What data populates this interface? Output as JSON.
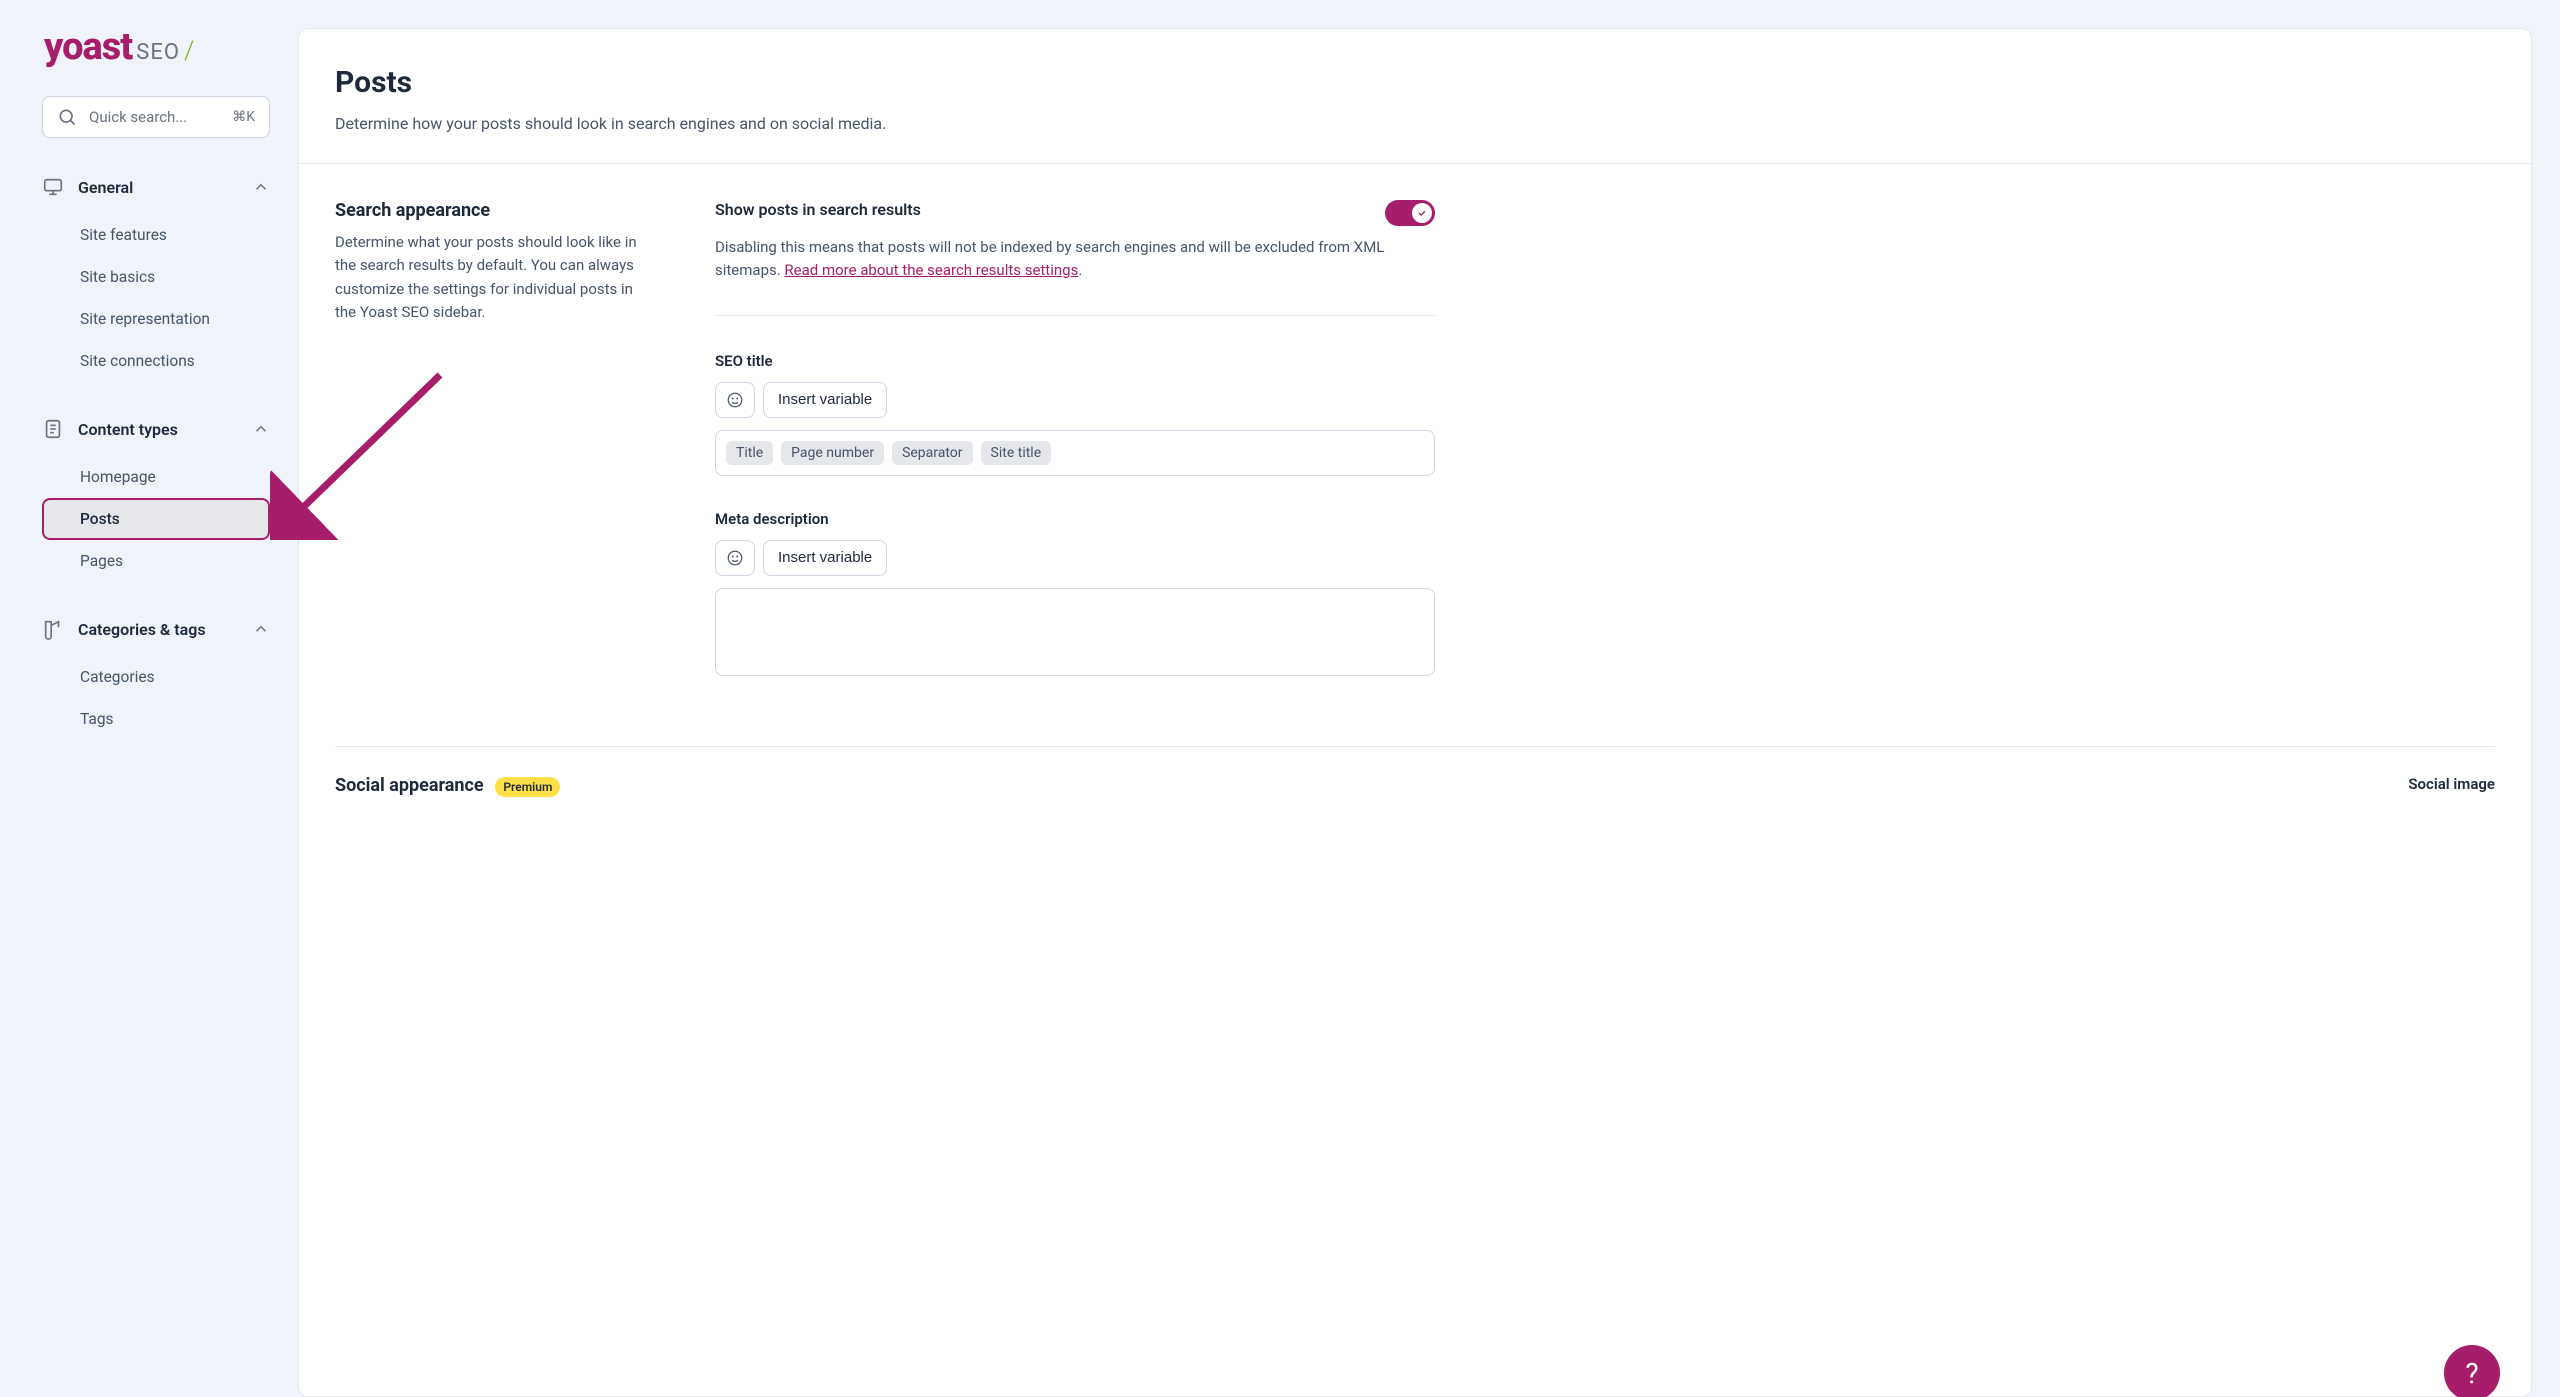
{
  "logo": {
    "main": "yoast",
    "suffix": "SEO",
    "slash": "/"
  },
  "search": {
    "placeholder": "Quick search...",
    "shortcut": "⌘K"
  },
  "nav": {
    "sections": [
      {
        "label": "General",
        "items": [
          "Site features",
          "Site basics",
          "Site representation",
          "Site connections"
        ]
      },
      {
        "label": "Content types",
        "items": [
          "Homepage",
          "Posts",
          "Pages"
        ],
        "active_index": 1
      },
      {
        "label": "Categories & tags",
        "items": [
          "Categories",
          "Tags"
        ]
      }
    ]
  },
  "page": {
    "title": "Posts",
    "subtitle": "Determine how your posts should look in search engines and on social media."
  },
  "search_appearance": {
    "heading": "Search appearance",
    "description": "Determine what your posts should look like in the search results by default. You can always customize the settings for individual posts in the Yoast SEO sidebar."
  },
  "toggle": {
    "label": "Show posts in search results",
    "on": true,
    "desc_prefix": "Disabling this means that posts will not be indexed by search engines and will be excluded from XML sitemaps. ",
    "link_text": "Read more about the search results settings",
    "desc_suffix": "."
  },
  "seo_title": {
    "label": "SEO title",
    "insert_btn": "Insert variable",
    "tags": [
      "Title",
      "Page number",
      "Separator",
      "Site title"
    ]
  },
  "meta_description": {
    "label": "Meta description",
    "insert_btn": "Insert variable"
  },
  "social": {
    "heading": "Social appearance",
    "badge": "Premium",
    "image_label": "Social image"
  },
  "help": "?"
}
